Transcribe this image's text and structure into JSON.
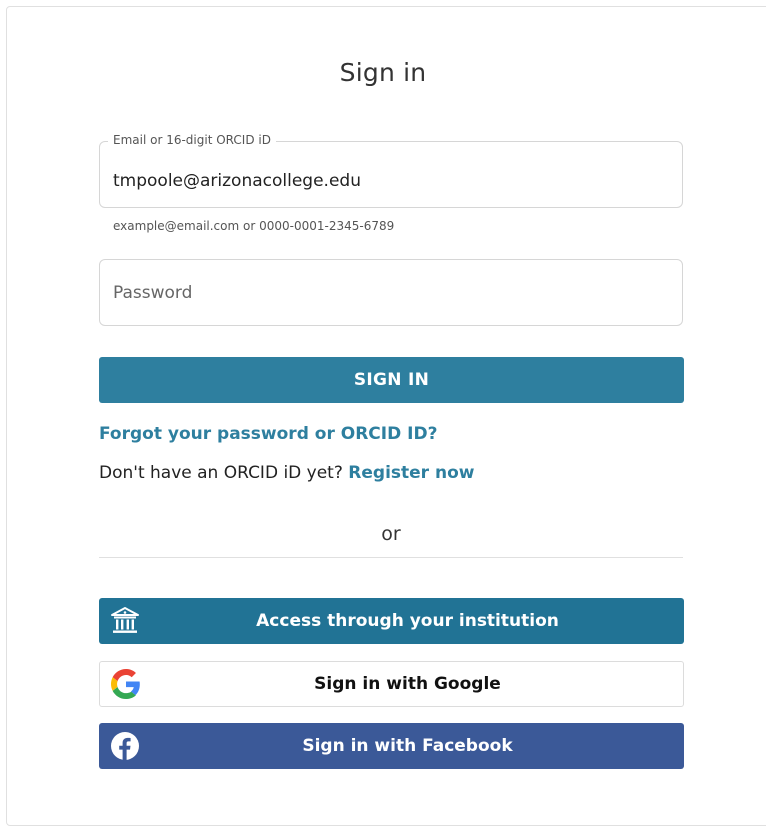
{
  "page": {
    "title": "Sign in"
  },
  "email_field": {
    "label": "Email or 16-digit ORCID iD",
    "value": "tmpoole@arizonacollege.edu",
    "hint": "example@email.com or 0000-0001-2345-6789"
  },
  "password_field": {
    "placeholder": "Password",
    "value": ""
  },
  "sign_in_button": {
    "label": "SIGN IN"
  },
  "links": {
    "forgot": "Forgot your password or ORCID ID?",
    "register_prompt": "Don't have an ORCID iD yet?",
    "register_link": "Register now"
  },
  "divider": {
    "text": "or"
  },
  "alternatives": {
    "institution": {
      "label": "Access through your institution",
      "icon": "institution-icon"
    },
    "google": {
      "label": "Sign in with Google",
      "icon": "google-icon"
    },
    "facebook": {
      "label": "Sign in with Facebook",
      "icon": "facebook-icon"
    }
  },
  "colors": {
    "primary": "#2e7f9f",
    "institution": "#217395",
    "facebook": "#3b5998"
  }
}
